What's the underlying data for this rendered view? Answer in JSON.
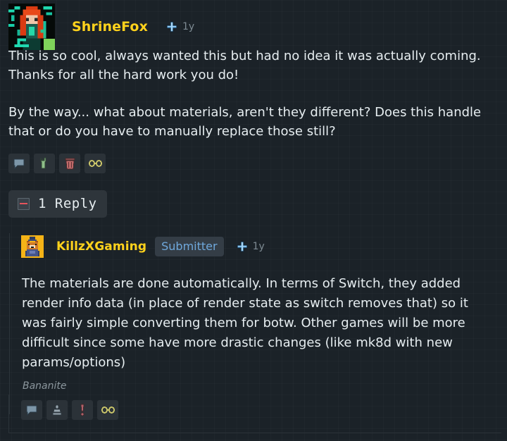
{
  "comment": {
    "avatar_alt": "shrinefox-avatar",
    "online_status": "online",
    "username": "ShrineFox",
    "supporter_icon": "plus-badge-icon",
    "timestamp": "1y",
    "paragraphs": [
      "This is so cool, always wanted this but had no idea it was actually coming. Thanks for all the hard work you do!",
      "By the way... what about materials, aren't they different? Does this handle that or do you have to manually replace those still?"
    ],
    "actions": [
      {
        "name": "reply-icon",
        "label": "Reply",
        "color": "#7d96a8"
      },
      {
        "name": "wrench-icon",
        "label": "Edit",
        "color": "#8fbf8a"
      },
      {
        "name": "trash-icon",
        "label": "Delete",
        "color": "#bf6a6a"
      },
      {
        "name": "link-icon",
        "label": "Permalink",
        "color": "#c9c469"
      }
    ]
  },
  "reply_toggle": {
    "collapse_icon": "collapse-minus-icon",
    "label": "1 Reply"
  },
  "reply": {
    "avatar_alt": "killzxgaming-avatar",
    "username": "KillzXGaming",
    "badge": "Submitter",
    "supporter_icon": "plus-badge-icon",
    "timestamp": "1y",
    "text": "The materials are done automatically. In terms of Switch, they added render info data (in place of render state as switch removes that) so it was fairly simple converting them for botw. Other games will be more difficult since some have more drastic changes (like mk8d with new params/options)",
    "rank": "Bananite",
    "actions": [
      {
        "name": "reply-icon",
        "label": "Reply",
        "color": "#7d96a8"
      },
      {
        "name": "stamp-icon",
        "label": "Stamp",
        "color": "#9aa7b0"
      },
      {
        "name": "report-icon",
        "label": "Report",
        "color": "#b1626a"
      },
      {
        "name": "link-icon",
        "label": "Permalink",
        "color": "#c9c469"
      }
    ]
  },
  "colors": {
    "background": "#1b2228",
    "username": "#ffd21c",
    "badge_text": "#6fa8dc",
    "online": "#7fd35a"
  }
}
